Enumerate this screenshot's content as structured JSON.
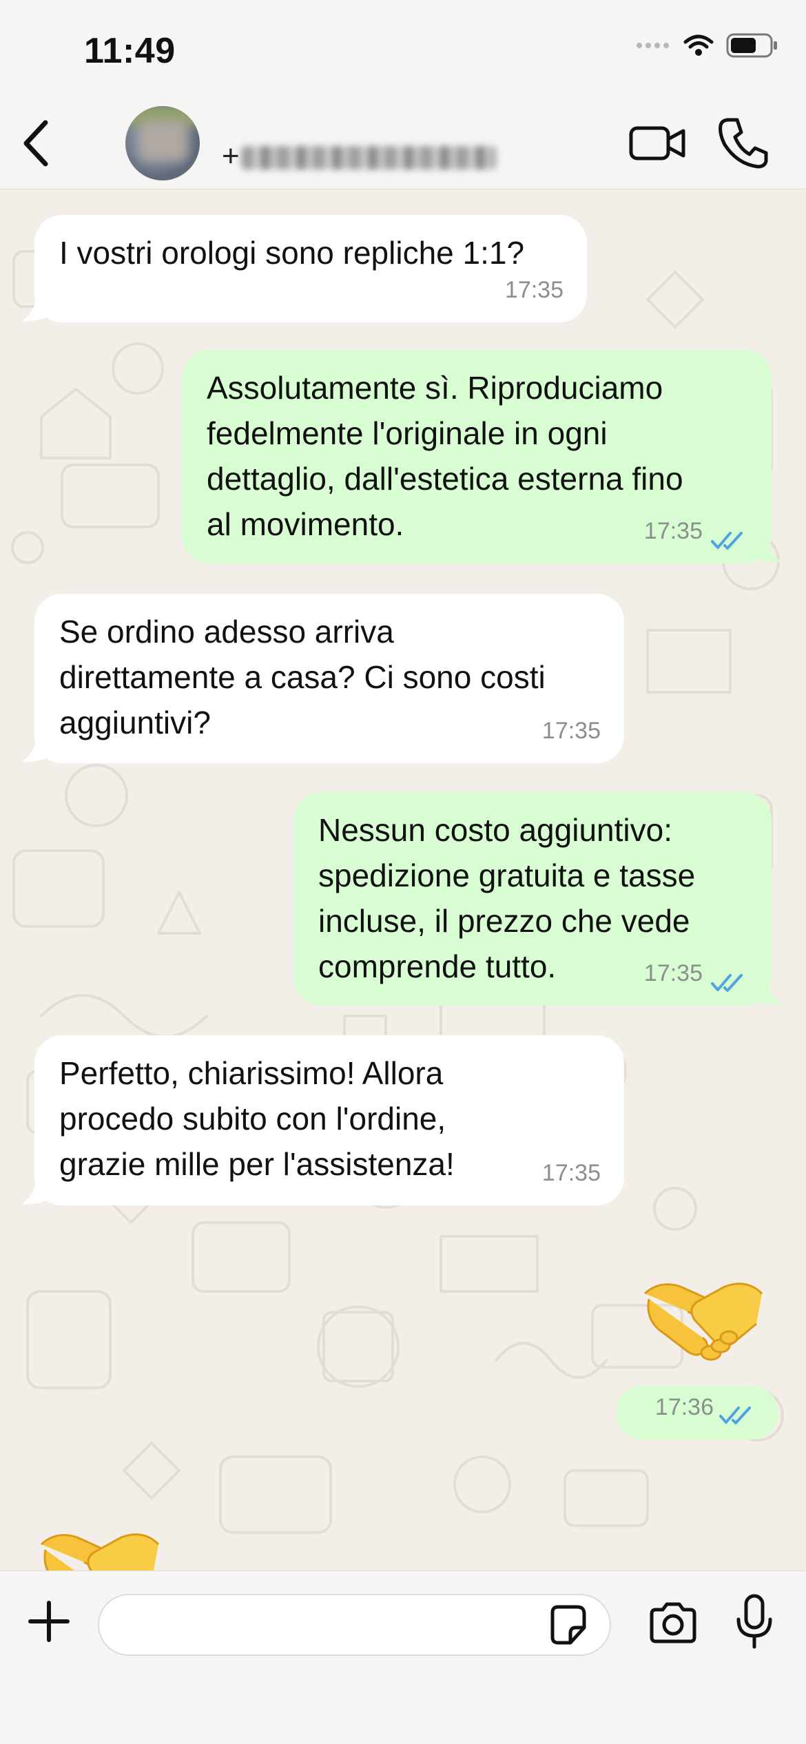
{
  "status_bar": {
    "time": "11:49",
    "icons": [
      "cellular-icon",
      "wifi-icon",
      "battery-icon"
    ]
  },
  "header": {
    "back_icon": "chevron-left-icon",
    "contact_prefix": "+",
    "video_icon": "video-camera-icon",
    "call_icon": "phone-icon"
  },
  "messages": [
    {
      "direction": "in",
      "lines": [
        "I vostri orologi sono repliche 1:1?"
      ],
      "time": "17:35"
    },
    {
      "direction": "out",
      "lines": [
        "Assolutamente sì. Riproduciamo",
        "fedelmente l'originale in ogni",
        "dettaglio, dall'estetica esterna fino",
        "al movimento."
      ],
      "time": "17:35",
      "status": "read"
    },
    {
      "direction": "in",
      "lines": [
        "Se ordino adesso arriva",
        "direttamente a casa? Ci sono costi",
        "aggiuntivi?"
      ],
      "time": "17:35"
    },
    {
      "direction": "out",
      "lines": [
        "Nessun costo aggiuntivo:",
        "spedizione gratuita e tasse",
        "incluse, il prezzo che vede",
        "comprende tutto."
      ],
      "time": "17:35",
      "status": "read"
    },
    {
      "direction": "in",
      "lines": [
        "Perfetto, chiarissimo! Allora",
        "procedo subito con l'ordine,",
        "grazie mille per l'assistenza!"
      ],
      "time": "17:35"
    },
    {
      "direction": "out",
      "emoji": "handshake",
      "time": "17:36",
      "status": "read"
    },
    {
      "direction": "in",
      "emoji": "handshake"
    }
  ],
  "input_bar": {
    "plus_icon": "plus-icon",
    "placeholder": "",
    "sticker_icon": "sticker-icon",
    "camera_icon": "camera-icon",
    "mic_icon": "microphone-icon"
  },
  "colors": {
    "incoming_bubble": "#ffffff",
    "outgoing_bubble": "#d9fdd3",
    "read_ticks": "#4fa3e0",
    "background": "#f3efe8"
  }
}
